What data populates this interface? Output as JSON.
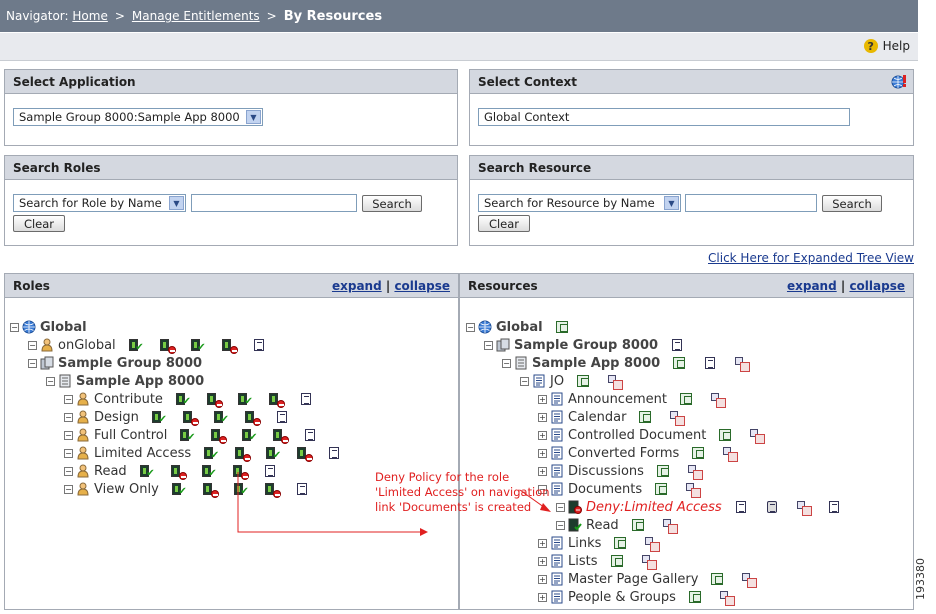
{
  "nav": {
    "prefix": "Navigator:",
    "home": "Home",
    "sep1": ">",
    "manage": "Manage Entitlements",
    "sep2": ">",
    "current": "By Resources"
  },
  "toolbar": {
    "help": "Help"
  },
  "select_application": {
    "title": "Select Application",
    "value": "Sample Group 8000:Sample App 8000"
  },
  "select_context": {
    "title": "Select Context",
    "value": "Global Context"
  },
  "search_roles": {
    "title": "Search Roles",
    "type_value": "Search for Role by Name",
    "search": "Search",
    "clear": "Clear"
  },
  "search_resource": {
    "title": "Search Resource",
    "type_value": "Search for Resource by Name",
    "search": "Search",
    "clear": "Clear"
  },
  "expanded_tree_link": "Click Here for Expanded Tree View",
  "roles_panel": {
    "title": "Roles",
    "expand": "expand",
    "sep": "|",
    "collapse": "collapse",
    "nodes": {
      "global": "Global",
      "onglobal": "onGlobal",
      "group": "Sample Group 8000",
      "app": "Sample App 8000",
      "contribute": "Contribute",
      "design": "Design",
      "fullcontrol": "Full Control",
      "limited": "Limited Access",
      "read": "Read",
      "viewonly": "View Only"
    }
  },
  "resources_panel": {
    "title": "Resources",
    "expand": "expand",
    "sep": "|",
    "collapse": "collapse",
    "nodes": {
      "global": "Global",
      "group": "Sample Group 8000",
      "app": "Sample App 8000",
      "jo": "JO",
      "announcement": "Announcement",
      "calendar": "Calendar",
      "controlled": "Controlled Document",
      "converted": "Converted Forms",
      "discussions": "Discussions",
      "documents": "Documents",
      "deny": "Deny:Limited Access",
      "read": "Read",
      "links": "Links",
      "lists": "Lists",
      "masterpage": "Master Page Gallery",
      "people": "People & Groups"
    }
  },
  "annotation": {
    "line1": "Deny Policy for the role",
    "line2": "'Limited Access' on navigation",
    "line3": "link 'Documents' is created"
  },
  "side_label": "193380",
  "colors": {
    "nav_bg": "#6e7a8a",
    "panel_head": "#d4d8e0",
    "link": "#1a3a8f",
    "annotation": "#e02020"
  }
}
